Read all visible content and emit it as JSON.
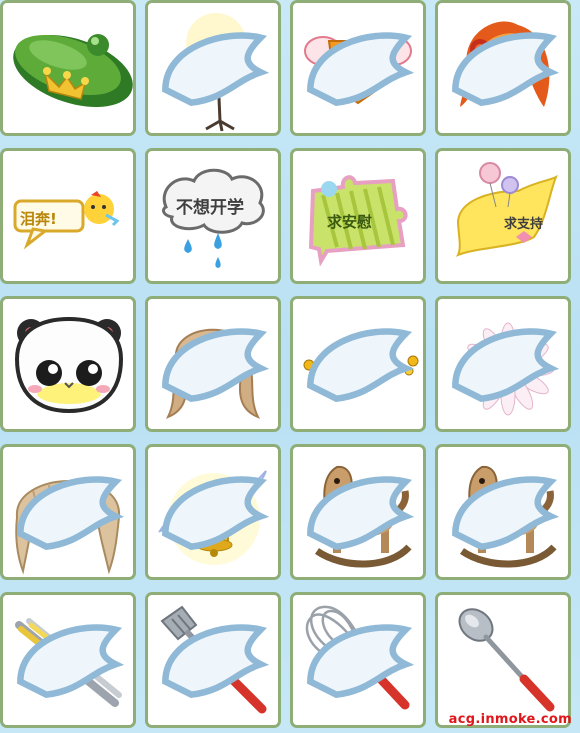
{
  "items": [
    {
      "name": "green-beret-crown-hat",
      "label": ""
    },
    {
      "name": "music-stand",
      "label": ""
    },
    {
      "name": "orange-corset-top",
      "label": ""
    },
    {
      "name": "orange-red-hair",
      "label": ""
    },
    {
      "name": "tears-bubble",
      "label": "泪奔!"
    },
    {
      "name": "no-school-cloud-bubble",
      "label": "不想开学"
    },
    {
      "name": "comfort-puzzle-bubble",
      "label": "求安慰"
    },
    {
      "name": "support-lollipop-bubble",
      "label": "求支持"
    },
    {
      "name": "panda-face",
      "label": ""
    },
    {
      "name": "blonde-pigtail-hair",
      "label": ""
    },
    {
      "name": "gold-stud-earrings",
      "label": ""
    },
    {
      "name": "white-daisy-flower",
      "label": ""
    },
    {
      "name": "blonde-short-hair",
      "label": ""
    },
    {
      "name": "angel-wing-bell",
      "label": ""
    },
    {
      "name": "rocking-horse-pink",
      "label": ""
    },
    {
      "name": "rocking-horse-blue",
      "label": ""
    },
    {
      "name": "kitchen-tongs",
      "label": ""
    },
    {
      "name": "slotted-spatula",
      "label": ""
    },
    {
      "name": "egg-whisk",
      "label": ""
    },
    {
      "name": "soup-ladle",
      "label": ""
    }
  ],
  "watermark": "acg.inmoke.com",
  "colors": {
    "border": "#8fae77",
    "background": "#c9e9f7",
    "watermark": "#e0161b"
  }
}
